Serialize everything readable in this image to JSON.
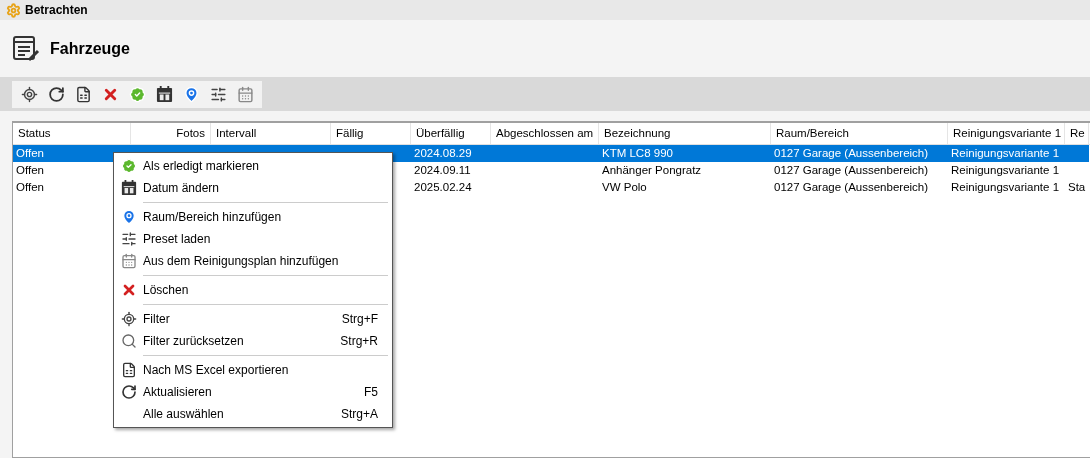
{
  "window": {
    "title": "Betrachten"
  },
  "page": {
    "title": "Fahrzeuge"
  },
  "table": {
    "columns": [
      {
        "label": "Status"
      },
      {
        "label": "Fotos"
      },
      {
        "label": "Intervall"
      },
      {
        "label": "Fällig"
      },
      {
        "label": "Überfällig"
      },
      {
        "label": "Abgeschlossen am"
      },
      {
        "label": "Bezeichnung"
      },
      {
        "label": "Raum/Bereich"
      },
      {
        "label": "Reinigungsvariante 1"
      },
      {
        "label": "Re"
      }
    ],
    "rows": [
      {
        "selected": true,
        "cells": [
          "Offen",
          "",
          "",
          "",
          "2024.08.29",
          "",
          "KTM LC8 990",
          "0127 Garage (Aussenbereich)",
          "Reinigungsvariante 1",
          ""
        ]
      },
      {
        "selected": false,
        "cells": [
          "Offen",
          "",
          "",
          "",
          "2024.09.11",
          "",
          "Anhänger Pongratz",
          "0127 Garage (Aussenbereich)",
          "Reinigungsvariante 1",
          ""
        ]
      },
      {
        "selected": false,
        "cells": [
          "Offen",
          "",
          "",
          "",
          "2025.02.24",
          "",
          "VW Polo",
          "0127 Garage (Aussenbereich)",
          "Reinigungsvariante 1",
          "Sta"
        ]
      }
    ]
  },
  "context_menu": [
    {
      "kind": "item",
      "label": "Als erledigt markieren"
    },
    {
      "kind": "item",
      "label": "Datum ändern"
    },
    {
      "kind": "separator"
    },
    {
      "kind": "item",
      "label": "Raum/Bereich hinzufügen"
    },
    {
      "kind": "item",
      "label": "Preset laden"
    },
    {
      "kind": "item",
      "label": "Aus dem Reinigungsplan hinzufügen"
    },
    {
      "kind": "separator"
    },
    {
      "kind": "item",
      "label": "Löschen"
    },
    {
      "kind": "separator"
    },
    {
      "kind": "item",
      "label": "Filter",
      "shortcut": "Strg+F"
    },
    {
      "kind": "item",
      "label": "Filter zurücksetzen",
      "shortcut": "Strg+R"
    },
    {
      "kind": "separator"
    },
    {
      "kind": "item",
      "label": "Nach MS Excel exportieren"
    },
    {
      "kind": "item",
      "label": "Aktualisieren",
      "shortcut": "F5"
    },
    {
      "kind": "item",
      "label": "Alle auswählen",
      "shortcut": "Strg+A"
    }
  ]
}
